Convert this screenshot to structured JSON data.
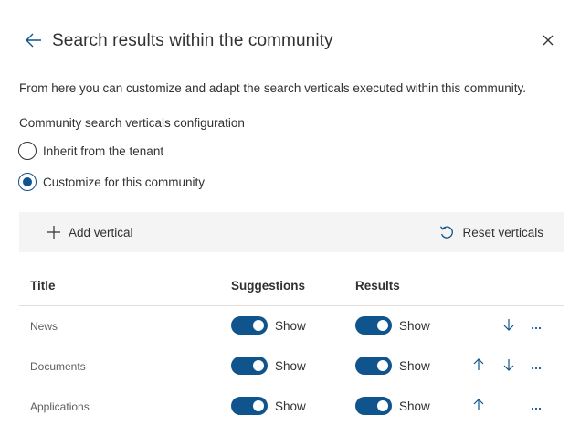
{
  "header": {
    "title": "Search results within the community"
  },
  "description": "From here you can customize and adapt the search verticals executed within this community.",
  "config": {
    "label": "Community search verticals configuration",
    "options": [
      {
        "label": "Inherit from the tenant",
        "checked": false
      },
      {
        "label": "Customize for this community",
        "checked": true
      }
    ]
  },
  "command_bar": {
    "add_label": "Add vertical",
    "reset_label": "Reset verticals"
  },
  "table": {
    "columns": [
      "Title",
      "Suggestions",
      "Results"
    ],
    "rows": [
      {
        "title": "News",
        "suggestions": "Show",
        "results": "Show",
        "suggestions_on": true,
        "results_on": true,
        "move_up": false,
        "move_down": true
      },
      {
        "title": "Documents",
        "suggestions": "Show",
        "results": "Show",
        "suggestions_on": true,
        "results_on": true,
        "move_up": true,
        "move_down": true
      },
      {
        "title": "Applications",
        "suggestions": "Show",
        "results": "Show",
        "suggestions_on": true,
        "results_on": true,
        "move_up": true,
        "move_down": false
      }
    ]
  },
  "colors": {
    "accent": "#0f548c",
    "command_bar_bg": "#f4f4f4",
    "text": "#323130",
    "muted_text": "#605e5c"
  }
}
